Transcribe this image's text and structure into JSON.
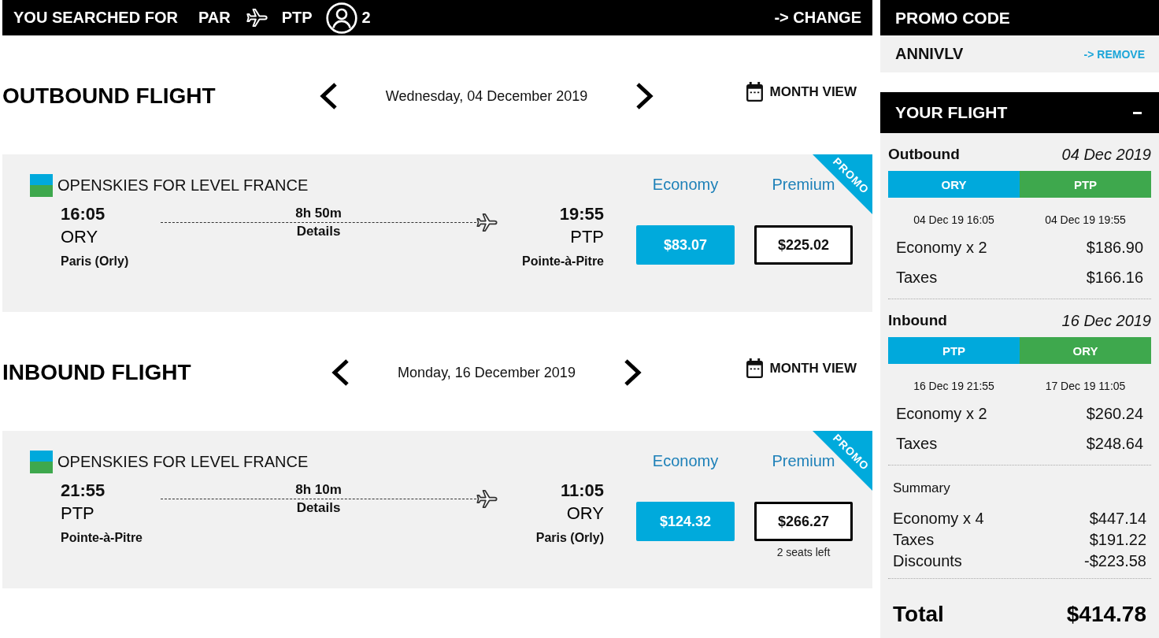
{
  "search_bar": {
    "label": "YOU SEARCHED FOR",
    "origin": "PAR",
    "destination": "PTP",
    "passengers": "2",
    "change_link": "-> CHANGE"
  },
  "flights": [
    {
      "title": "OUTBOUND FLIGHT",
      "date": "Wednesday, 04 December 2019",
      "month_view": "MONTH VIEW",
      "card": {
        "airline": "OPENSKIES FOR LEVEL FRANCE",
        "depart_time": "16:05",
        "depart_code": "ORY",
        "depart_city": "Paris (Orly)",
        "duration": "8h 50m",
        "details_link": "Details",
        "arrive_time": "19:55",
        "arrive_code": "PTP",
        "arrive_city": "Pointe-à-Pitre",
        "ribbon": "PROMO",
        "fares": [
          {
            "name": "Economy",
            "price": "$83.07",
            "selected": true
          },
          {
            "name": "Premium",
            "price": "$225.02",
            "selected": false
          }
        ]
      }
    },
    {
      "title": "INBOUND FLIGHT",
      "date": "Monday, 16 December 2019",
      "month_view": "MONTH VIEW",
      "card": {
        "airline": "OPENSKIES FOR LEVEL FRANCE",
        "depart_time": "21:55",
        "depart_code": "PTP",
        "depart_city": "Pointe-à-Pitre",
        "duration": "8h 10m",
        "details_link": "Details",
        "arrive_time": "11:05",
        "arrive_code": "ORY",
        "arrive_city": "Paris (Orly)",
        "ribbon": "PROMO",
        "fares": [
          {
            "name": "Economy",
            "price": "$124.32",
            "selected": true
          },
          {
            "name": "Premium",
            "price": "$266.27",
            "selected": false,
            "note": "2 seats left"
          }
        ]
      }
    }
  ],
  "sidebar": {
    "promo_code": {
      "title": "PROMO CODE",
      "code": "ANNIVLV",
      "remove_link": "-> REMOVE"
    },
    "your_flight": {
      "title": "YOUR FLIGHT",
      "expanded": true,
      "legs": [
        {
          "name": "Outbound",
          "date": "04 Dec 2019",
          "from": "ORY",
          "to": "PTP",
          "depart": "04 Dec 19 16:05",
          "arrive": "04 Dec 19 19:55",
          "lines": [
            {
              "label": "Economy x 2",
              "amount": "$186.90"
            },
            {
              "label": "Taxes",
              "amount": "$166.16"
            }
          ]
        },
        {
          "name": "Inbound",
          "date": "16 Dec 2019",
          "from": "PTP",
          "to": "ORY",
          "depart": "16 Dec 19 21:55",
          "arrive": "17 Dec 19 11:05",
          "lines": [
            {
              "label": "Economy x 2",
              "amount": "$260.24"
            },
            {
              "label": "Taxes",
              "amount": "$248.64"
            }
          ]
        }
      ],
      "summary": {
        "title": "Summary",
        "lines": [
          {
            "label": "Economy x 4",
            "amount": "$447.14"
          },
          {
            "label": "Taxes",
            "amount": "$191.22"
          },
          {
            "label": "Discounts",
            "amount": "-$223.58"
          }
        ]
      },
      "total": {
        "label": "Total",
        "amount": "$414.78"
      }
    }
  }
}
